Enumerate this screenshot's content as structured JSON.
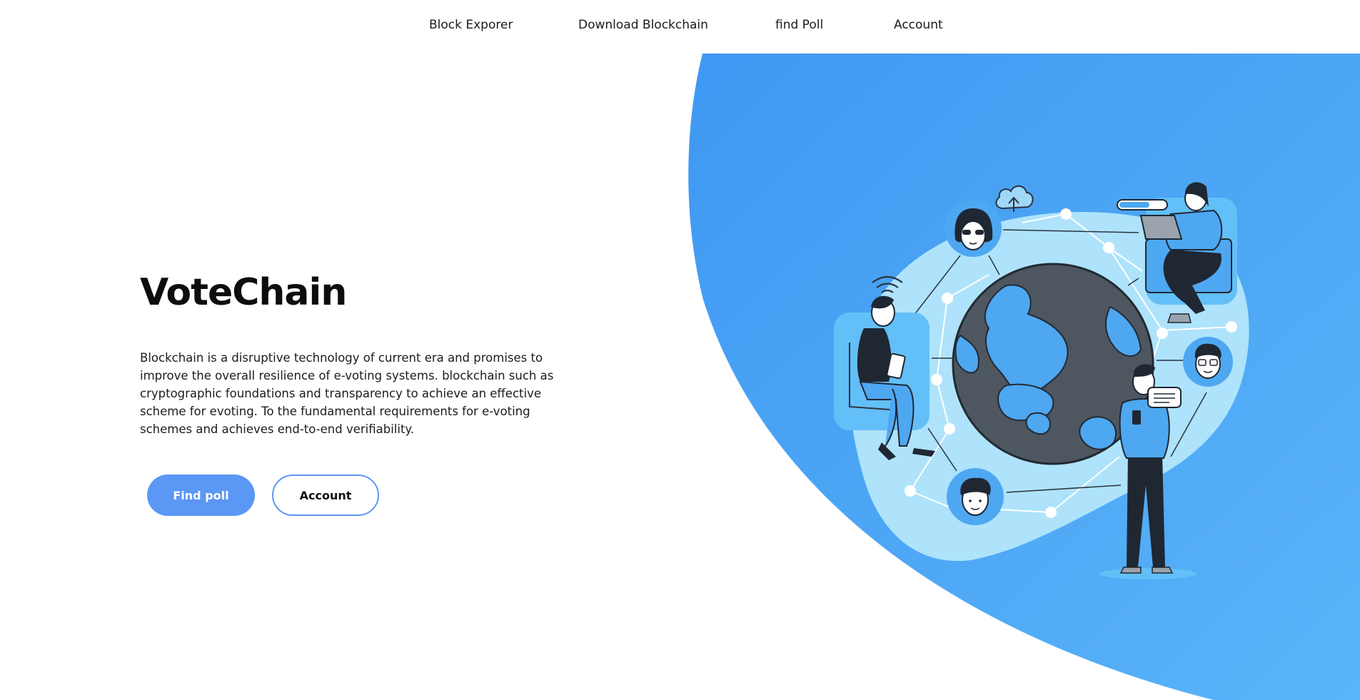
{
  "nav": {
    "items": [
      {
        "label": "Block Exporer"
      },
      {
        "label": "Download Blockchain"
      },
      {
        "label": "find Poll"
      },
      {
        "label": "Account"
      }
    ]
  },
  "hero": {
    "title": "VoteChain",
    "description": "Blockchain is a disruptive technology of current era and promises to improve the overall resilience of e-voting systems. blockchain such as cryptographic foundations and transparency to achieve an effective scheme for evoting. To the fundamental requirements for e-voting schemes and achieves end-to-end verifiability.",
    "primary_button": "Find poll",
    "secondary_button": "Account"
  },
  "colors": {
    "accent": "#5b97f5",
    "hero_blue": "#4aa2f4",
    "light_blue": "#aee3fb",
    "dark_globe": "#4e5660"
  },
  "illustration": {
    "icon": "blockchain-network-illustration"
  }
}
